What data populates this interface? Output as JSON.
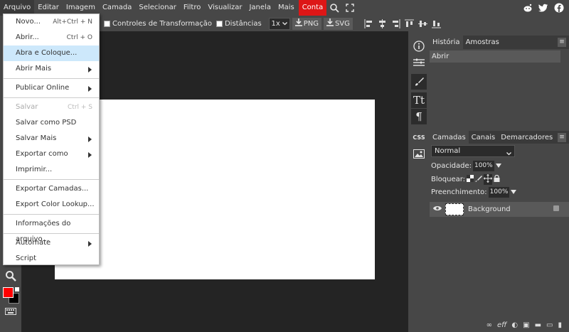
{
  "menubar": {
    "items": [
      "Arquivo",
      "Editar",
      "Imagem",
      "Camada",
      "Selecionar",
      "Filtro",
      "Visualizar",
      "Janela",
      "Mais"
    ],
    "account_label": "Conta",
    "account_color": "#dd1616"
  },
  "optionsbar": {
    "transform_controls_label": "Controles de Transformação",
    "distances_label": "Distâncias",
    "zoom_value": "1x",
    "export_png_label": "PNG",
    "export_svg_label": "SVG"
  },
  "file_menu": {
    "items": [
      {
        "label": "Novo...",
        "shortcut": "Alt+Ctrl + N"
      },
      {
        "label": "Abrir...",
        "shortcut": "Ctrl + O"
      },
      {
        "label": "Abra e Coloque...",
        "shortcut": ""
      },
      {
        "label": "Abrir Mais",
        "shortcut": ""
      },
      {
        "label": "Publicar Online",
        "shortcut": ""
      },
      {
        "label": "Salvar",
        "shortcut": "Ctrl + S"
      },
      {
        "label": "Salvar como PSD",
        "shortcut": ""
      },
      {
        "label": "Salvar Mais",
        "shortcut": ""
      },
      {
        "label": "Exportar como",
        "shortcut": ""
      },
      {
        "label": "Imprimir...",
        "shortcut": ""
      },
      {
        "label": "Exportar Camadas...",
        "shortcut": ""
      },
      {
        "label": "Export Color Lookup...",
        "shortcut": ""
      },
      {
        "label": "Informações do arquivo...",
        "shortcut": ""
      },
      {
        "label": "Automate",
        "shortcut": ""
      },
      {
        "label": "Script",
        "shortcut": ""
      }
    ]
  },
  "right_tools": {
    "css_label": "CSS"
  },
  "history_panel": {
    "tabs": [
      "História",
      "Amostras"
    ],
    "rows": [
      "Abrir"
    ]
  },
  "layers_panel": {
    "tabs": [
      "Camadas",
      "Canais",
      "Demarcadores"
    ],
    "blend_mode": "Normal",
    "opacity_label": "Opacidade:",
    "opacity_value": "100%",
    "lock_label": "Bloquear:",
    "fill_label": "Preenchimento:",
    "fill_value": "100%",
    "layers": [
      {
        "name": "Background"
      }
    ]
  },
  "colors": {
    "foreground": "#ff0000",
    "background": "#000000"
  }
}
